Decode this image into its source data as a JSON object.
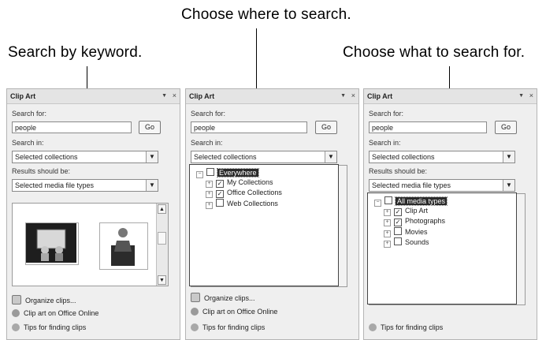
{
  "callouts": {
    "search_keyword": "Search by keyword.",
    "search_where": "Choose where to search.",
    "search_what": "Choose what to search for."
  },
  "pane": {
    "title": "Clip Art",
    "dropdown_glyph": "▼",
    "close_glyph": "×",
    "search_for_label": "Search for:",
    "search_value": "people",
    "go_label": "Go",
    "search_in_label": "Search in:",
    "search_in_value": "Selected collections",
    "results_label": "Results should be:",
    "results_value": "Selected media file types",
    "organize_link": "Organize clips...",
    "online_link": "Clip art on Office Online",
    "tips_link": "Tips for finding clips"
  },
  "collections_tree": [
    {
      "label": "Everywhere",
      "checked": false
    },
    {
      "label": "My Collections",
      "checked": true
    },
    {
      "label": "Office Collections",
      "checked": true
    },
    {
      "label": "Web Collections",
      "checked": false
    }
  ],
  "media_tree": [
    {
      "label": "All media types",
      "checked": false
    },
    {
      "label": "Clip Art",
      "checked": true
    },
    {
      "label": "Photographs",
      "checked": true
    },
    {
      "label": "Movies",
      "checked": false
    },
    {
      "label": "Sounds",
      "checked": false
    }
  ],
  "colors": {
    "pane_bg": "#efefef",
    "selection": "#2a2a2a"
  },
  "icons": {
    "scroll_up": "▲",
    "scroll_down": "▼",
    "select_arrow": "▼",
    "expand": "+",
    "check": "✓"
  }
}
